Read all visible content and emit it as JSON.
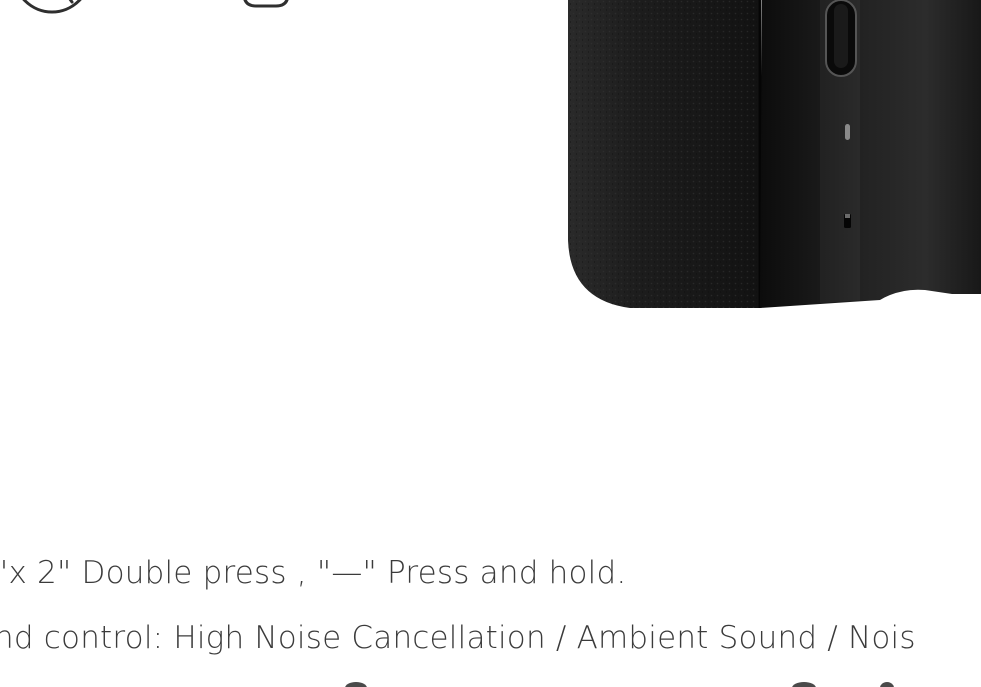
{
  "instructions": {
    "line1": "\"x 2\" Double press , \"—\" Press and hold.",
    "line2": "nd control: High Noise Cancellation / Ambient Sound / Nois"
  },
  "icons": {
    "top_left_1": "play-circle-icon",
    "top_left_2": "rounded-square-icon"
  },
  "colors": {
    "text": "#3b3b3b",
    "earcup": "#1a1a1a",
    "background": "#ffffff"
  }
}
